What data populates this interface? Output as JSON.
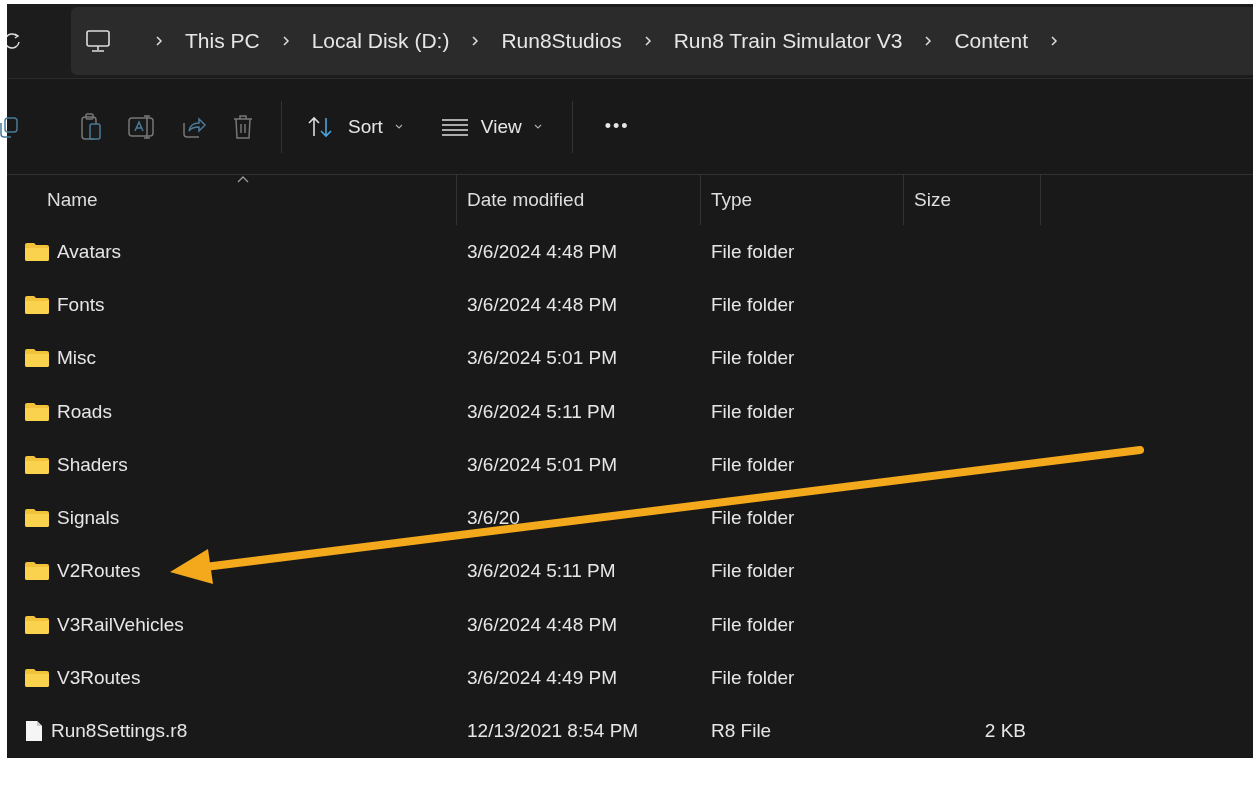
{
  "breadcrumb": [
    "This PC",
    "Local Disk (D:)",
    "Run8Studios",
    "Run8 Train Simulator V3",
    "Content"
  ],
  "toolbar": {
    "sort": "Sort",
    "view": "View",
    "more": "•••"
  },
  "columns": [
    "Name",
    "Date modified",
    "Type",
    "Size"
  ],
  "rows": [
    {
      "kind": "folder",
      "name": "Avatars",
      "date": "3/6/2024 4:48 PM",
      "type": "File folder"
    },
    {
      "kind": "folder",
      "name": "Fonts",
      "date": "3/6/2024 4:48 PM",
      "type": "File folder"
    },
    {
      "kind": "folder",
      "name": "Misc",
      "date": "3/6/2024 5:01 PM",
      "type": "File folder"
    },
    {
      "kind": "folder",
      "name": "Roads",
      "date": "3/6/2024 5:11 PM",
      "type": "File folder"
    },
    {
      "kind": "folder",
      "name": "Shaders",
      "date": "3/6/2024 5:01 PM",
      "type": "File folder"
    },
    {
      "kind": "folder",
      "name": "Signals",
      "date": "3/6/20",
      "type": "File folder"
    },
    {
      "kind": "folder",
      "name": "V2Routes",
      "date": "3/6/2024 5:11 PM",
      "type": "File folder"
    },
    {
      "kind": "folder",
      "name": "V3RailVehicles",
      "date": "3/6/2024 4:48 PM",
      "type": "File folder"
    },
    {
      "kind": "folder",
      "name": "V3Routes",
      "date": "3/6/2024 4:49 PM",
      "type": "File folder"
    },
    {
      "kind": "file",
      "name": "Run8Settings.r8",
      "date": "12/13/2021 8:54 PM",
      "type": "R8 File",
      "size": "2 KB"
    }
  ]
}
